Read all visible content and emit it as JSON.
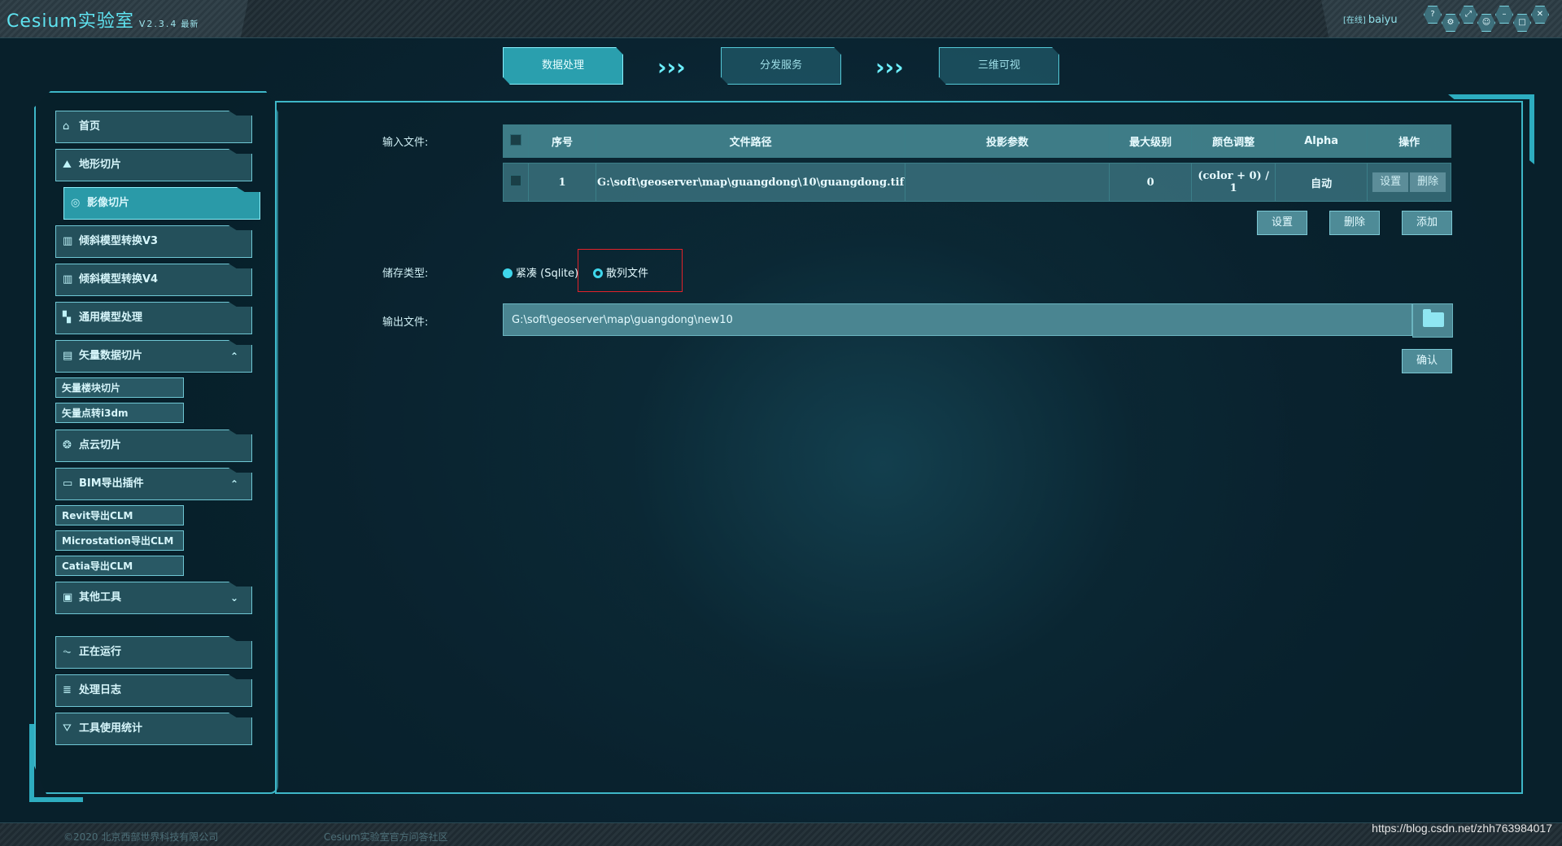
{
  "app": {
    "title": "Cesium实验室",
    "version": "V2.3.4",
    "badge": "最新"
  },
  "user": {
    "status": "[在线]",
    "name": "baiyu"
  },
  "header_icons": [
    "help-icon",
    "settings-icon",
    "link-icon",
    "user-icon",
    "minimize-icon",
    "maximize-icon",
    "close-icon"
  ],
  "steps": [
    {
      "label": "数据处理",
      "active": true
    },
    {
      "label": "分发服务",
      "active": false
    },
    {
      "label": "三维可视",
      "active": false
    }
  ],
  "sidebar": {
    "items": [
      {
        "label": "首页",
        "icon": "home-icon"
      },
      {
        "label": "地形切片",
        "icon": "terrain-icon"
      },
      {
        "label": "影像切片",
        "icon": "image-icon"
      },
      {
        "label": "倾斜模型转换V3",
        "icon": "building-icon"
      },
      {
        "label": "倾斜模型转换V4",
        "icon": "building-icon"
      },
      {
        "label": "通用模型处理",
        "icon": "model-icon"
      },
      {
        "label": "矢量数据切片",
        "icon": "vector-icon"
      },
      {
        "label": "点云切片",
        "icon": "pointcloud-icon"
      },
      {
        "label": "BIM导出插件",
        "icon": "bim-icon"
      },
      {
        "label": "其他工具",
        "icon": "tools-icon"
      },
      {
        "label": "正在运行",
        "icon": "running-icon"
      },
      {
        "label": "处理日志",
        "icon": "log-icon"
      },
      {
        "label": "工具使用统计",
        "icon": "stats-icon"
      }
    ],
    "vector_sub": [
      "矢量楼块切片",
      "矢量点转i3dm"
    ],
    "bim_sub": [
      "Revit导出CLM",
      "Microstation导出CLM",
      "Catia导出CLM"
    ]
  },
  "form": {
    "input_label": "输入文件:",
    "storage_label": "储存类型:",
    "output_label": "输出文件:",
    "table": {
      "headers": [
        "序号",
        "文件路径",
        "投影参数",
        "最大级别",
        "颜色调整",
        "Alpha",
        "操作"
      ],
      "rows": [
        {
          "index": "1",
          "path": "G:\\soft\\geoserver\\map\\guangdong\\10\\guangdong.tif",
          "projection": "",
          "max_level": "0",
          "color": "(color + 0) / 1",
          "alpha": "自动",
          "ops": [
            "设置",
            "删除"
          ]
        }
      ]
    },
    "table_actions": [
      "设置",
      "删除",
      "添加"
    ],
    "storage_options": [
      {
        "label": "紧凑 (Sqlite)",
        "selected": false
      },
      {
        "label": "散列文件",
        "selected": true
      }
    ],
    "output_path": "G:\\soft\\geoserver\\map\\guangdong\\new10",
    "confirm_label": "确认"
  },
  "footer": {
    "copyright": "©2020 北京西部世界科技有限公司",
    "community": "Cesium实验室官方问答社区",
    "watermark": "https://blog.csdn.net/zhh763984017"
  }
}
